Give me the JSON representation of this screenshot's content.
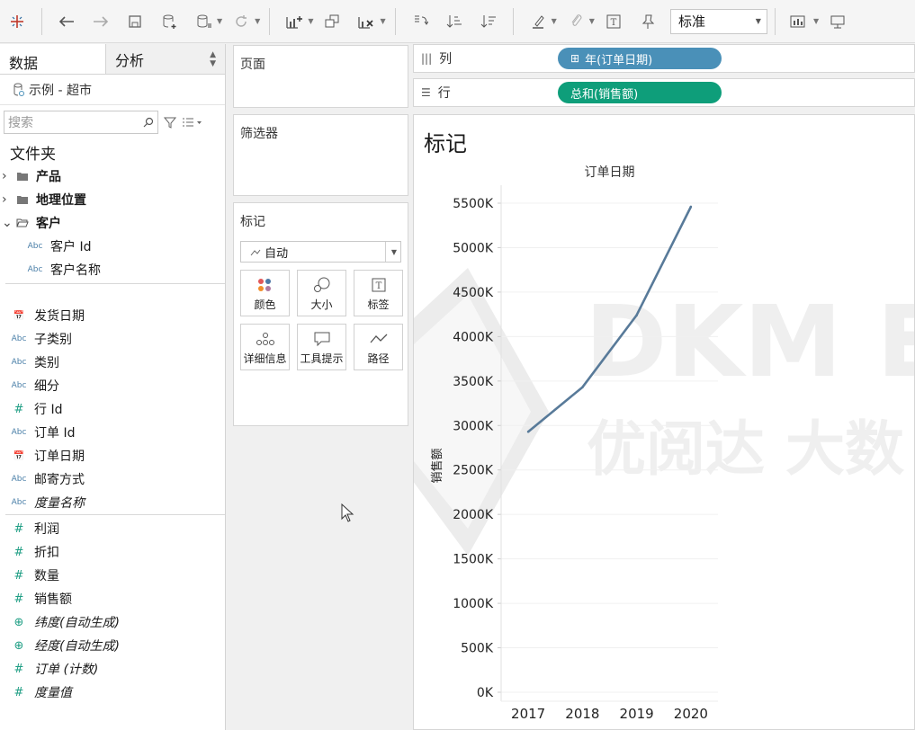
{
  "toolbar": {
    "fit_select": "标准"
  },
  "data_pane": {
    "tabs": [
      "数据",
      "分析"
    ],
    "datasource": "示例 - 超市",
    "search_placeholder": "搜索",
    "folder_title": "文件夹",
    "folders": [
      {
        "label": "产品",
        "expanded": false
      },
      {
        "label": "地理位置",
        "expanded": false
      },
      {
        "label": "客户",
        "expanded": true
      }
    ],
    "customer_fields": [
      {
        "type": "Abc",
        "label": "客户 Id"
      },
      {
        "type": "Abc",
        "label": "客户名称"
      }
    ],
    "dimensions": [
      {
        "type": "date",
        "label": "发货日期",
        "italic": false
      },
      {
        "type": "Abc",
        "label": "子类别",
        "italic": false
      },
      {
        "type": "Abc",
        "label": "类别",
        "italic": false
      },
      {
        "type": "Abc",
        "label": "细分",
        "italic": false
      },
      {
        "type": "#",
        "label": "行 Id",
        "italic": false
      },
      {
        "type": "Abc",
        "label": "订单 Id",
        "italic": false
      },
      {
        "type": "date",
        "label": "订单日期",
        "italic": false
      },
      {
        "type": "Abc",
        "label": "邮寄方式",
        "italic": false
      },
      {
        "type": "Abc",
        "label": "度量名称",
        "italic": true
      }
    ],
    "measures": [
      {
        "type": "#",
        "label": "利润",
        "italic": false
      },
      {
        "type": "#",
        "label": "折扣",
        "italic": false
      },
      {
        "type": "#",
        "label": "数量",
        "italic": false
      },
      {
        "type": "#",
        "label": "销售额",
        "italic": false
      },
      {
        "type": "geo",
        "label": "纬度(自动生成)",
        "italic": true
      },
      {
        "type": "geo",
        "label": "经度(自动生成)",
        "italic": true
      },
      {
        "type": "#",
        "label": "订单 (计数)",
        "italic": true
      },
      {
        "type": "#",
        "label": "度量值",
        "italic": true
      }
    ]
  },
  "cards": {
    "pages": "页面",
    "filters": "筛选器",
    "marks": "标记",
    "marks_type": "自动",
    "mark_buttons": [
      "颜色",
      "大小",
      "标签",
      "详细信息",
      "工具提示",
      "路径"
    ]
  },
  "shelves": {
    "columns_label": "列",
    "columns_pill": "年(订单日期)",
    "rows_label": "行",
    "rows_pill": "总和(销售额)"
  },
  "viz": {
    "title": "标记",
    "watermark_line1": "DKM E",
    "watermark_line2": "优阅达 大数"
  },
  "chart_data": {
    "type": "line",
    "title": "订单日期",
    "xlabel": "",
    "ylabel": "销售额",
    "categories": [
      "2017",
      "2018",
      "2019",
      "2020"
    ],
    "values": [
      2930000,
      3430000,
      4240000,
      5460000
    ],
    "ylim": [
      0,
      5500000
    ],
    "y_ticks": [
      0,
      500000,
      1000000,
      1500000,
      2000000,
      2500000,
      3000000,
      3500000,
      4000000,
      4500000,
      5000000,
      5500000
    ],
    "y_tick_labels": [
      "0K",
      "500K",
      "1000K",
      "1500K",
      "2000K",
      "2500K",
      "3000K",
      "3500K",
      "4000K",
      "4500K",
      "5000K",
      "5500K"
    ],
    "line_color": "#587a99",
    "grid": true
  }
}
